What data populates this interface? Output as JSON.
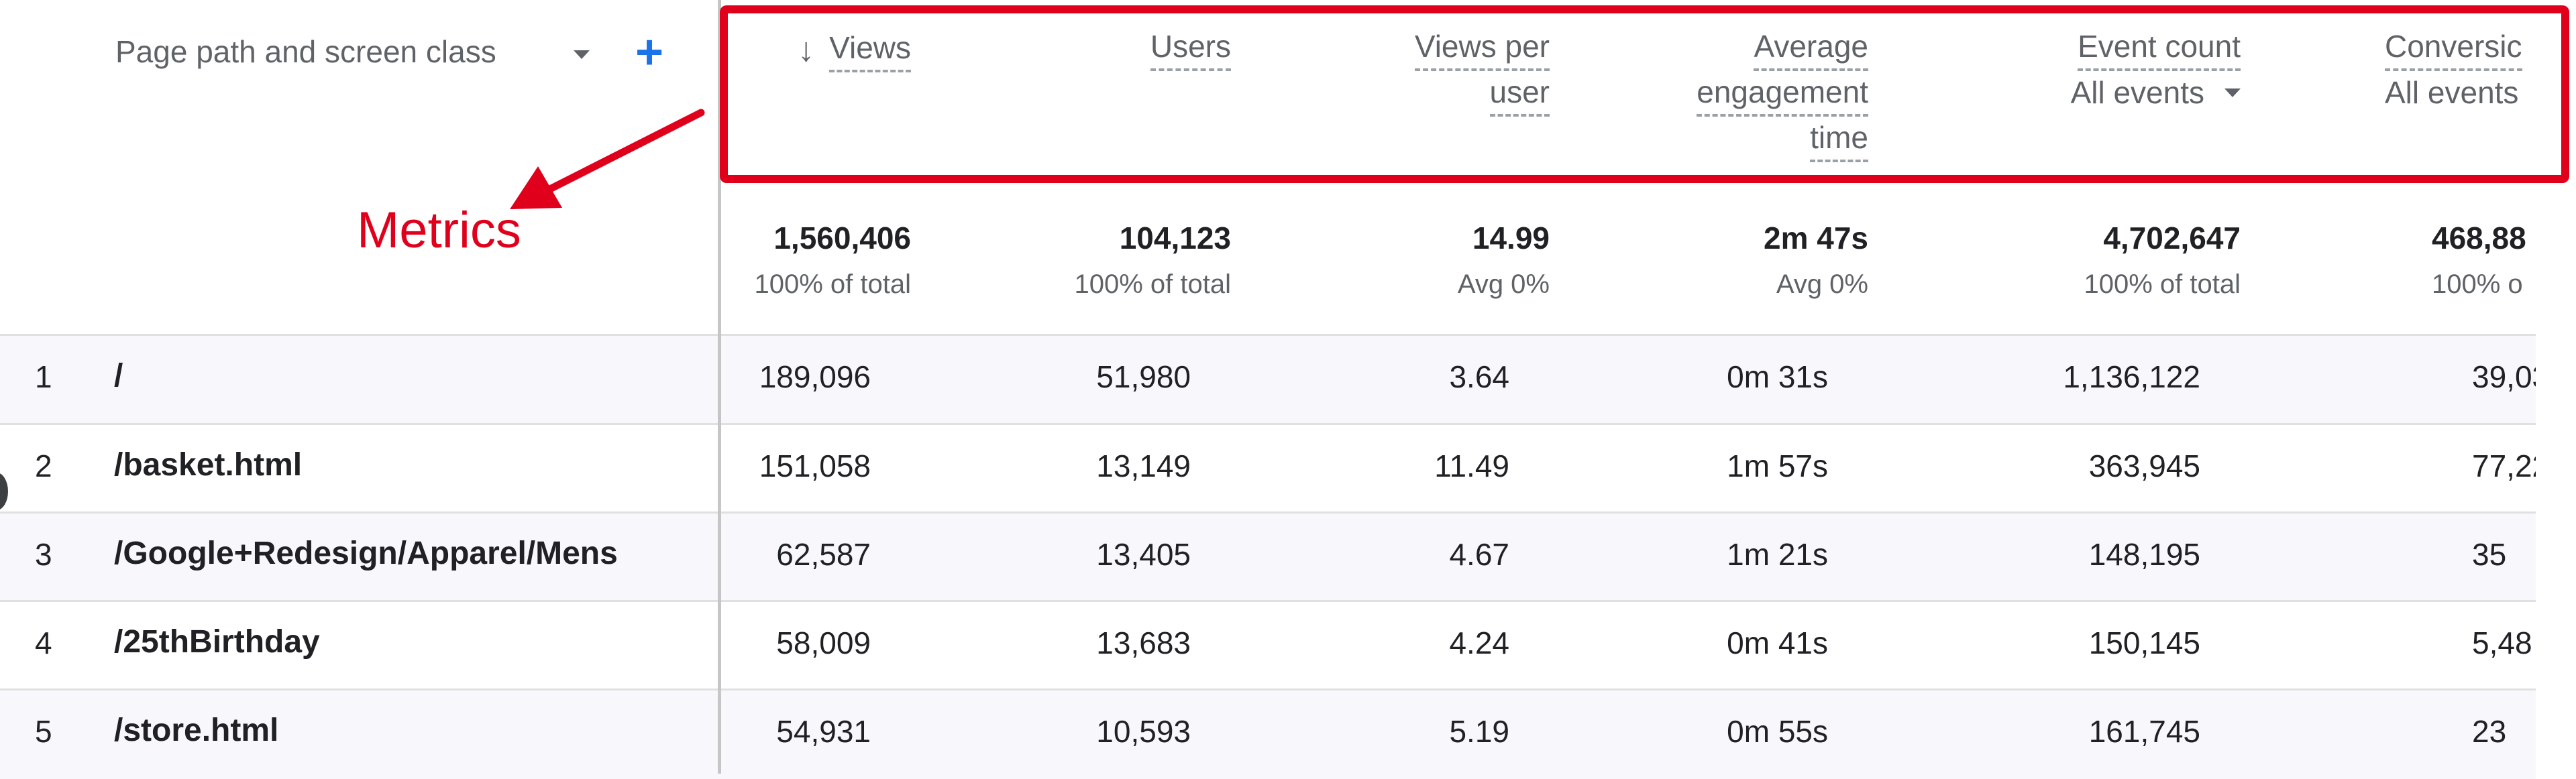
{
  "dimension": {
    "label": "Page path and screen class"
  },
  "annotation": {
    "label": "Metrics"
  },
  "columns": [
    {
      "key": "views",
      "lines": [
        "Views"
      ],
      "sorted": true
    },
    {
      "key": "users",
      "lines": [
        "Users"
      ]
    },
    {
      "key": "views_per_user",
      "lines": [
        "Views per",
        "user"
      ]
    },
    {
      "key": "avg_engagement",
      "lines": [
        "Average",
        "engagement",
        "time"
      ]
    },
    {
      "key": "event_count",
      "lines": [
        "Event count"
      ],
      "sub": "All events"
    },
    {
      "key": "conversions",
      "lines": [
        "Conversic"
      ],
      "sub": "All events"
    }
  ],
  "totals": [
    {
      "value": "1,560,406",
      "sub": "100% of total"
    },
    {
      "value": "104,123",
      "sub": "100% of total"
    },
    {
      "value": "14.99",
      "sub": "Avg 0%"
    },
    {
      "value": "2m 47s",
      "sub": "Avg 0%"
    },
    {
      "value": "4,702,647",
      "sub": "100% of total"
    },
    {
      "value": "468,88",
      "sub": "100% o"
    }
  ],
  "rows": [
    {
      "num": "1",
      "path": "/",
      "cells": [
        "189,096",
        "51,980",
        "3.64",
        "0m 31s",
        "1,136,122",
        "39,03"
      ]
    },
    {
      "num": "2",
      "path": "/basket.html",
      "cells": [
        "151,058",
        "13,149",
        "11.49",
        "1m 57s",
        "363,945",
        "77,22"
      ]
    },
    {
      "num": "3",
      "path": "/Google+Redesign/Apparel/Mens",
      "cells": [
        "62,587",
        "13,405",
        "4.67",
        "1m 21s",
        "148,195",
        "35"
      ]
    },
    {
      "num": "4",
      "path": "/25thBirthday",
      "cells": [
        "58,009",
        "13,683",
        "4.24",
        "0m 41s",
        "150,145",
        "5,48"
      ]
    },
    {
      "num": "5",
      "path": "/store.html",
      "cells": [
        "54,931",
        "10,593",
        "5.19",
        "0m 55s",
        "161,745",
        "23"
      ]
    }
  ],
  "colors": {
    "accent": "#1a73e8",
    "annotation": "#e0001b",
    "row_alt": "#f8f8fc"
  }
}
